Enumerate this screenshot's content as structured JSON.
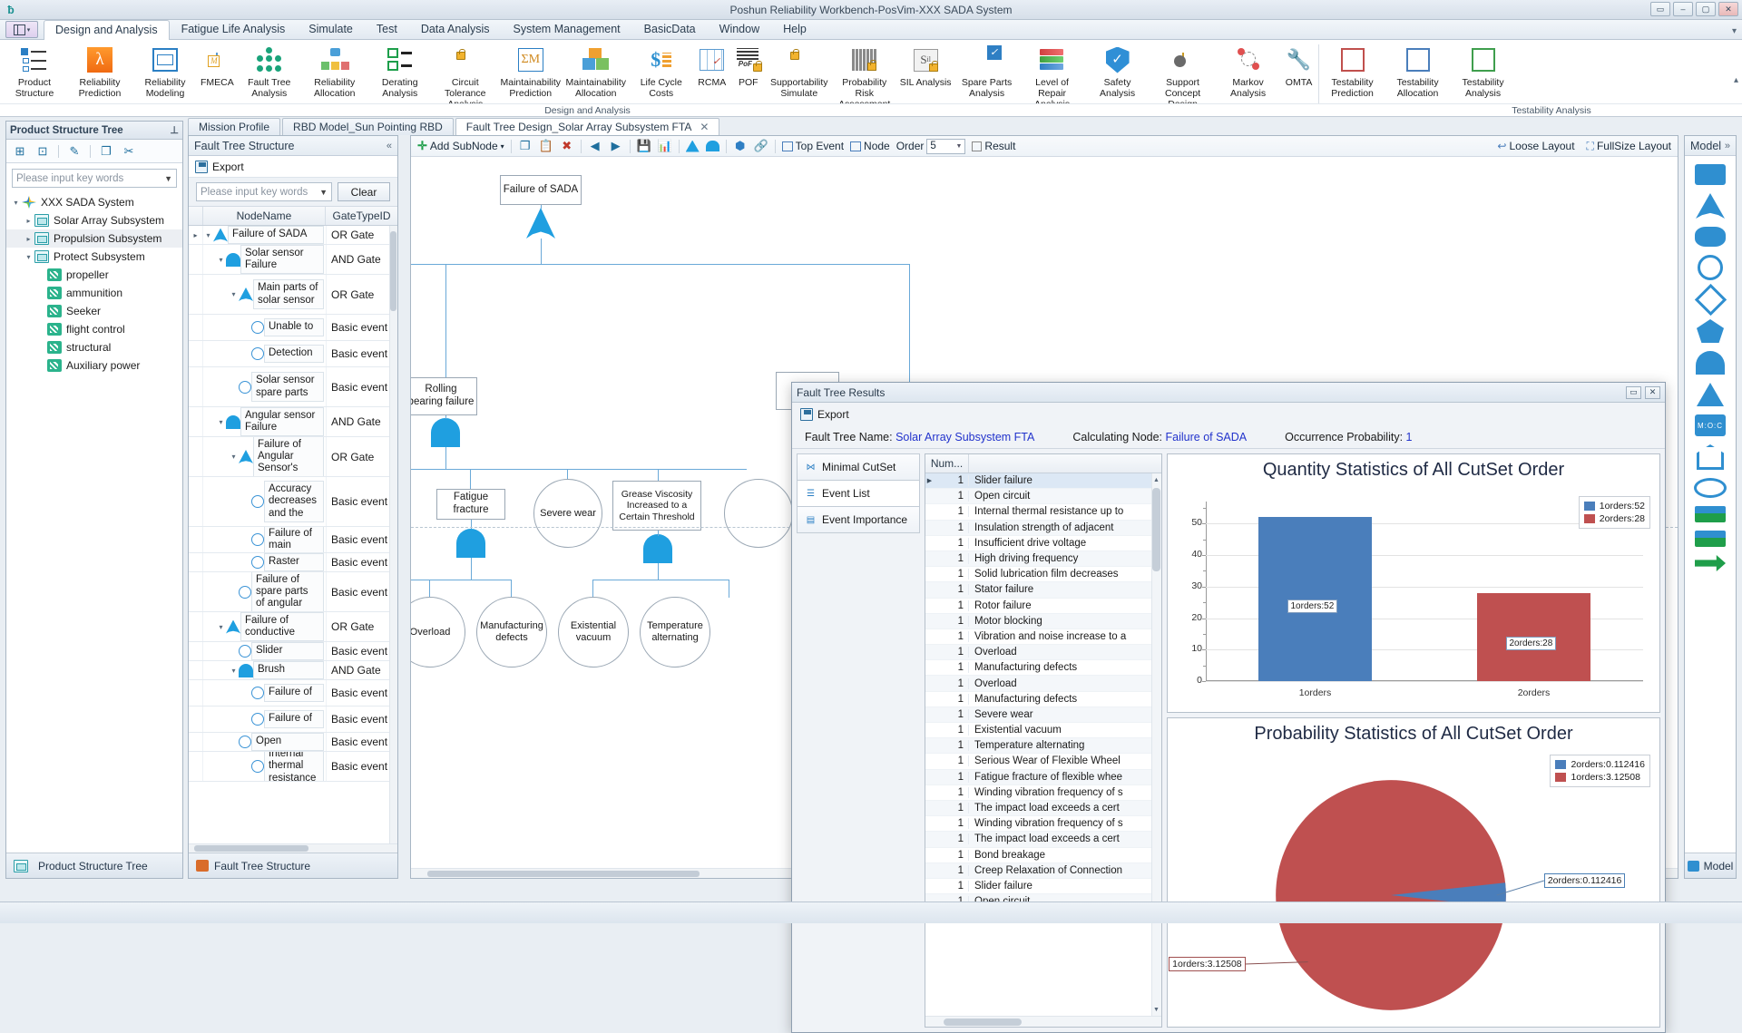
{
  "window": {
    "title": "Poshun Reliability Workbench-PosVim-XXX SADA System",
    "quick_access_icon": "app-logo-icon",
    "buttons": [
      "restore-small",
      "minimize",
      "maximize",
      "close"
    ],
    "button_glyphs": [
      "▭",
      "–",
      "▢",
      "✕"
    ]
  },
  "menubar": {
    "ribbon_toggle": "ribbon-display-options",
    "tabs": [
      {
        "label": "Design and Analysis",
        "active": true
      },
      {
        "label": "Fatigue Life Analysis",
        "active": false
      },
      {
        "label": "Simulate",
        "active": false
      },
      {
        "label": "Test",
        "active": false
      },
      {
        "label": "Data Analysis",
        "active": false
      },
      {
        "label": "System Management",
        "active": false
      },
      {
        "label": "BasicData",
        "active": false
      },
      {
        "label": "Window",
        "active": false
      },
      {
        "label": "Help",
        "active": false
      }
    ]
  },
  "ribbon": {
    "groups": [
      {
        "label": "Design and Analysis"
      },
      {
        "label": "Testability Analysis"
      }
    ],
    "items": [
      {
        "label": "Product Structure",
        "icon": "product-structure-icon"
      },
      {
        "label": "Reliability Prediction",
        "icon": "lambda-icon"
      },
      {
        "label": "Reliability Modeling",
        "icon": "block-diagram-icon"
      },
      {
        "label": "FMECA",
        "icon": "fmeca-grid-icon"
      },
      {
        "label": "Fault Tree Analysis",
        "icon": "fault-tree-network-icon"
      },
      {
        "label": "Reliability Allocation",
        "icon": "allocation-icon"
      },
      {
        "label": "Derating Analysis",
        "icon": "derating-checklist-icon"
      },
      {
        "label": "Circuit Tolerance Analysis",
        "icon": "circuit-tolerance-icon"
      },
      {
        "label": "Maintainability Prediction",
        "icon": "maintainability-prediction-icon"
      },
      {
        "label": "Maintainability Allocation",
        "icon": "maintainability-allocation-icon"
      },
      {
        "label": "Life Cycle Costs",
        "icon": "life-cycle-cost-icon"
      },
      {
        "label": "RCMA",
        "icon": "rcma-icon"
      },
      {
        "label": "POF",
        "icon": "pof-icon"
      },
      {
        "label": "Supportability Simulate",
        "icon": "supportability-simulate-icon"
      },
      {
        "label": "Probability Risk Assessment",
        "icon": "probability-risk-icon"
      },
      {
        "label": "SIL Analysis",
        "icon": "sil-analysis-icon"
      },
      {
        "label": "Spare Parts Analysis",
        "icon": "spare-parts-icon"
      },
      {
        "label": "Level of Repair Analysis",
        "icon": "level-of-repair-icon"
      },
      {
        "label": "Safety Analysis",
        "icon": "safety-shield-icon"
      },
      {
        "label": "Support Concept Design",
        "icon": "support-concept-icon"
      },
      {
        "label": "Markov Analysis",
        "icon": "markov-icon"
      },
      {
        "label": "OMTA",
        "icon": "omta-wrench-icon"
      },
      {
        "label": "Testability Prediction",
        "icon": "testability-prediction-icon"
      },
      {
        "label": "Testability Allocation",
        "icon": "testability-allocation-icon"
      },
      {
        "label": "Testability Analysis",
        "icon": "testability-analysis-icon"
      }
    ]
  },
  "product_tree_panel": {
    "title": "Product Structure Tree",
    "pin_icon": "pin-icon",
    "tools": [
      "add-node-icon",
      "add-child-icon",
      "edit-icon",
      "copy-icon",
      "cut-icon"
    ],
    "search_placeholder": "Please input key words",
    "footer_label": "Product Structure Tree",
    "footer_icon": "product-structure-icon",
    "nodes": [
      {
        "label": "XXX SADA System",
        "level": 0,
        "icon": "root-icon",
        "twisty": "▾",
        "selected": false
      },
      {
        "label": "Solar Array Subsystem",
        "level": 1,
        "icon": "subsystem-icon",
        "twisty": "▸",
        "selected": false
      },
      {
        "label": "Propulsion Subsystem",
        "level": 1,
        "icon": "subsystem-icon",
        "twisty": "▸",
        "selected": true
      },
      {
        "label": "Protect Subsystem",
        "level": 1,
        "icon": "subsystem-icon",
        "twisty": "▾",
        "selected": false
      },
      {
        "label": "propeller",
        "level": 2,
        "icon": "component-icon",
        "twisty": "",
        "selected": false
      },
      {
        "label": "ammunition",
        "level": 2,
        "icon": "component-icon",
        "twisty": "",
        "selected": false
      },
      {
        "label": "Seeker",
        "level": 2,
        "icon": "component-icon",
        "twisty": "",
        "selected": false
      },
      {
        "label": "flight control",
        "level": 2,
        "icon": "component-icon",
        "twisty": "",
        "selected": false
      },
      {
        "label": "structural",
        "level": 2,
        "icon": "component-icon",
        "twisty": "",
        "selected": false
      },
      {
        "label": "Auxiliary power",
        "level": 2,
        "icon": "component-icon",
        "twisty": "",
        "selected": false
      }
    ]
  },
  "doc_tabs": [
    {
      "label": "Mission Profile",
      "active": false,
      "closable": false
    },
    {
      "label": "RBD Model_Sun Pointing RBD",
      "active": false,
      "closable": false
    },
    {
      "label": "Fault Tree Design_Solar Array Subsystem FTA",
      "active": true,
      "closable": true,
      "close_glyph": "✕"
    }
  ],
  "structure_panel": {
    "title": "Fault Tree Structure",
    "collapse_icon": "collapse-left-icon",
    "export_label": "Export",
    "export_icon": "export-disk-icon",
    "search_placeholder": "Please input key words",
    "clear_label": "Clear",
    "columns": [
      "NodeName",
      "GateTypeID"
    ],
    "footer_label": "Fault Tree Structure",
    "footer_icon": "fault-tree-icon",
    "rows": [
      {
        "name": "Failure of SADA",
        "gate": "OR Gate",
        "indent": 0,
        "symbol": "or",
        "twisty": "▾",
        "rowmarker": "▸"
      },
      {
        "name": "Solar sensor Failure",
        "gate": "AND Gate",
        "indent": 1,
        "symbol": "and",
        "twisty": "▾",
        "rowmarker": ""
      },
      {
        "name": "Main parts of solar sensor",
        "gate": "OR Gate",
        "indent": 2,
        "symbol": "or",
        "twisty": "▾",
        "rowmarker": ""
      },
      {
        "name": "Unable to",
        "gate": "Basic event",
        "indent": 3,
        "symbol": "basic",
        "twisty": "",
        "rowmarker": ""
      },
      {
        "name": "Detection",
        "gate": "Basic event",
        "indent": 3,
        "symbol": "basic",
        "twisty": "",
        "rowmarker": ""
      },
      {
        "name": "Solar sensor spare parts",
        "gate": "Basic event",
        "indent": 2,
        "symbol": "basic",
        "twisty": "",
        "rowmarker": ""
      },
      {
        "name": "Angular sensor Failure",
        "gate": "AND Gate",
        "indent": 1,
        "symbol": "and",
        "twisty": "▾",
        "rowmarker": ""
      },
      {
        "name": "Failure of Angular Sensor's",
        "gate": "OR Gate",
        "indent": 2,
        "symbol": "or",
        "twisty": "▾",
        "rowmarker": ""
      },
      {
        "name": "Accuracy decreases and the",
        "gate": "Basic event",
        "indent": 3,
        "symbol": "basic",
        "twisty": "",
        "rowmarker": ""
      },
      {
        "name": "Failure of main",
        "gate": "Basic event",
        "indent": 3,
        "symbol": "basic",
        "twisty": "",
        "rowmarker": ""
      },
      {
        "name": "Raster",
        "gate": "Basic event",
        "indent": 3,
        "symbol": "basic",
        "twisty": "",
        "rowmarker": ""
      },
      {
        "name": "Failure of spare parts of angular",
        "gate": "Basic event",
        "indent": 2,
        "symbol": "basic",
        "twisty": "",
        "rowmarker": ""
      },
      {
        "name": "Failure of conductive",
        "gate": "OR Gate",
        "indent": 1,
        "symbol": "or",
        "twisty": "▾",
        "rowmarker": ""
      },
      {
        "name": "Slider",
        "gate": "Basic event",
        "indent": 2,
        "symbol": "basic",
        "twisty": "",
        "rowmarker": ""
      },
      {
        "name": "Brush",
        "gate": "AND Gate",
        "indent": 2,
        "symbol": "and",
        "twisty": "▾",
        "rowmarker": ""
      },
      {
        "name": "Failure of",
        "gate": "Basic event",
        "indent": 3,
        "symbol": "basic",
        "twisty": "",
        "rowmarker": ""
      },
      {
        "name": "Failure of",
        "gate": "Basic event",
        "indent": 3,
        "symbol": "basic",
        "twisty": "",
        "rowmarker": ""
      },
      {
        "name": "Open",
        "gate": "Basic event",
        "indent": 2,
        "symbol": "basic",
        "twisty": "",
        "rowmarker": ""
      },
      {
        "name": "Internal thermal resistance",
        "gate": "Basic event",
        "indent": 3,
        "symbol": "basic",
        "twisty": "",
        "rowmarker": ""
      }
    ]
  },
  "canvas_toolbar": {
    "add_subnode_label": "Add SubNode",
    "add_subnode_caret": "▾",
    "top_event_label": "Top Event",
    "node_label": "Node",
    "order_label": "Order",
    "order_value": "5",
    "result_label": "Result",
    "loose_layout_label": "Loose Layout",
    "fullsize_layout_label": "FullSize Layout",
    "icons": [
      "copy-icon",
      "paste-icon",
      "delete-icon",
      "prev-icon",
      "next-icon",
      "save-icon",
      "chart-icon",
      "or-gate-icon",
      "and-gate-icon",
      "cube-icon",
      "link-icon"
    ]
  },
  "fault_tree_diagram": {
    "nodes": [
      {
        "id": "n1",
        "label": "Failure of SADA",
        "shape": "box"
      },
      {
        "id": "n2",
        "label": "Rolling bearing failure",
        "shape": "box"
      },
      {
        "id": "n3",
        "label": "Fatigue fracture",
        "shape": "box"
      },
      {
        "id": "n4",
        "label": "Severe wear",
        "shape": "circle"
      },
      {
        "id": "n5",
        "label": "Grease Viscosity Increased to a Certain Threshold",
        "shape": "box"
      },
      {
        "id": "n6",
        "label": "Overload",
        "shape": "circle"
      },
      {
        "id": "n7",
        "label": "Manufacturing defects",
        "shape": "circle"
      },
      {
        "id": "n8",
        "label": "Existential vacuum",
        "shape": "circle"
      },
      {
        "id": "n9",
        "label": "Temperature alternating",
        "shape": "circle"
      }
    ]
  },
  "model_panel": {
    "title": "Model",
    "collapse_icon": "collapse-right-icon",
    "footer_label": "Model",
    "footer_icon": "model-icon",
    "shapes": [
      "rect-node",
      "or-gate",
      "wave-node",
      "circle-node",
      "diamond-node",
      "pentagon-node",
      "and-gate",
      "triangle-node",
      "moc-node",
      "house-node",
      "ellipse-node",
      "flag-node",
      "transfer-node",
      "arrow-node"
    ]
  },
  "results_dialog": {
    "title": "Fault Tree Results",
    "window_buttons": [
      "▭",
      "✕"
    ],
    "export_label": "Export",
    "export_icon": "export-disk-icon",
    "info": {
      "fault_tree_name_label": "Fault Tree Name:",
      "fault_tree_name_value": "Solar Array Subsystem FTA",
      "calculating_node_label": "Calculating Node:",
      "calculating_node_value": "Failure of SADA",
      "occurrence_label": "Occurrence Probability:",
      "occurrence_value": "1"
    },
    "nav": [
      {
        "label": "Minimal CutSet",
        "icon": "cutset-icon",
        "active": false
      },
      {
        "label": "Event List",
        "icon": "event-list-icon",
        "active": true
      },
      {
        "label": "Event Importance",
        "icon": "importance-icon",
        "active": false
      }
    ],
    "table": {
      "columns": [
        "Num...",
        ""
      ],
      "rows": [
        {
          "num": "1",
          "text": "Slider failure",
          "selected": true
        },
        {
          "num": "1",
          "text": "Open circuit",
          "selected": false
        },
        {
          "num": "1",
          "text": "Internal thermal resistance up to",
          "selected": false
        },
        {
          "num": "1",
          "text": "Insulation strength of adjacent",
          "selected": false
        },
        {
          "num": "1",
          "text": "Insufficient drive voltage",
          "selected": false
        },
        {
          "num": "1",
          "text": "High driving frequency",
          "selected": false
        },
        {
          "num": "1",
          "text": "Solid lubrication film decreases",
          "selected": false
        },
        {
          "num": "1",
          "text": "Stator failure",
          "selected": false
        },
        {
          "num": "1",
          "text": "Rotor failure",
          "selected": false
        },
        {
          "num": "1",
          "text": "Motor blocking",
          "selected": false
        },
        {
          "num": "1",
          "text": "Vibration and noise increase to a",
          "selected": false
        },
        {
          "num": "1",
          "text": "Overload",
          "selected": false
        },
        {
          "num": "1",
          "text": "Manufacturing defects",
          "selected": false
        },
        {
          "num": "1",
          "text": "Overload",
          "selected": false
        },
        {
          "num": "1",
          "text": "Manufacturing defects",
          "selected": false
        },
        {
          "num": "1",
          "text": "Severe wear",
          "selected": false
        },
        {
          "num": "1",
          "text": "Existential vacuum",
          "selected": false
        },
        {
          "num": "1",
          "text": "Temperature alternating",
          "selected": false
        },
        {
          "num": "1",
          "text": "Serious Wear of Flexible Wheel",
          "selected": false
        },
        {
          "num": "1",
          "text": "Fatigue fracture of flexible whee",
          "selected": false
        },
        {
          "num": "1",
          "text": "Winding vibration frequency of s",
          "selected": false
        },
        {
          "num": "1",
          "text": "The impact load exceeds a cert",
          "selected": false
        },
        {
          "num": "1",
          "text": "Winding vibration frequency of s",
          "selected": false
        },
        {
          "num": "1",
          "text": "The impact load exceeds a cert",
          "selected": false
        },
        {
          "num": "1",
          "text": "Bond breakage",
          "selected": false
        },
        {
          "num": "1",
          "text": "Creep Relaxation of Connection",
          "selected": false
        },
        {
          "num": "1",
          "text": "Slider failure",
          "selected": false
        },
        {
          "num": "1",
          "text": "Open circuit",
          "selected": false
        }
      ]
    }
  },
  "chart_data": [
    {
      "type": "bar",
      "title": "Quantity Statistics of All CutSet Order",
      "categories": [
        "1orders",
        "2orders"
      ],
      "values": [
        52,
        28
      ],
      "data_labels": [
        "1orders:52",
        "2orders:28"
      ],
      "colors": [
        "#4a7ebb",
        "#bf5050"
      ],
      "legend": [
        "1orders:52",
        "2orders:28"
      ],
      "legend_position": "top-right",
      "xlabel": "",
      "ylabel": "",
      "ylim": [
        0,
        57
      ],
      "yticks": [
        0,
        10,
        20,
        30,
        40,
        50
      ],
      "grid": true
    },
    {
      "type": "pie",
      "title": "Probability Statistics of All CutSet Order",
      "labels": [
        "1orders",
        "2orders"
      ],
      "values": [
        3.12508,
        0.112416
      ],
      "data_labels": [
        "1orders:3.12508",
        "2orders:0.112416"
      ],
      "colors": [
        "#bf5050",
        "#4a7ebb"
      ],
      "legend": [
        "2orders:0.112416",
        "1orders:3.12508"
      ],
      "legend_position": "top-right"
    }
  ]
}
